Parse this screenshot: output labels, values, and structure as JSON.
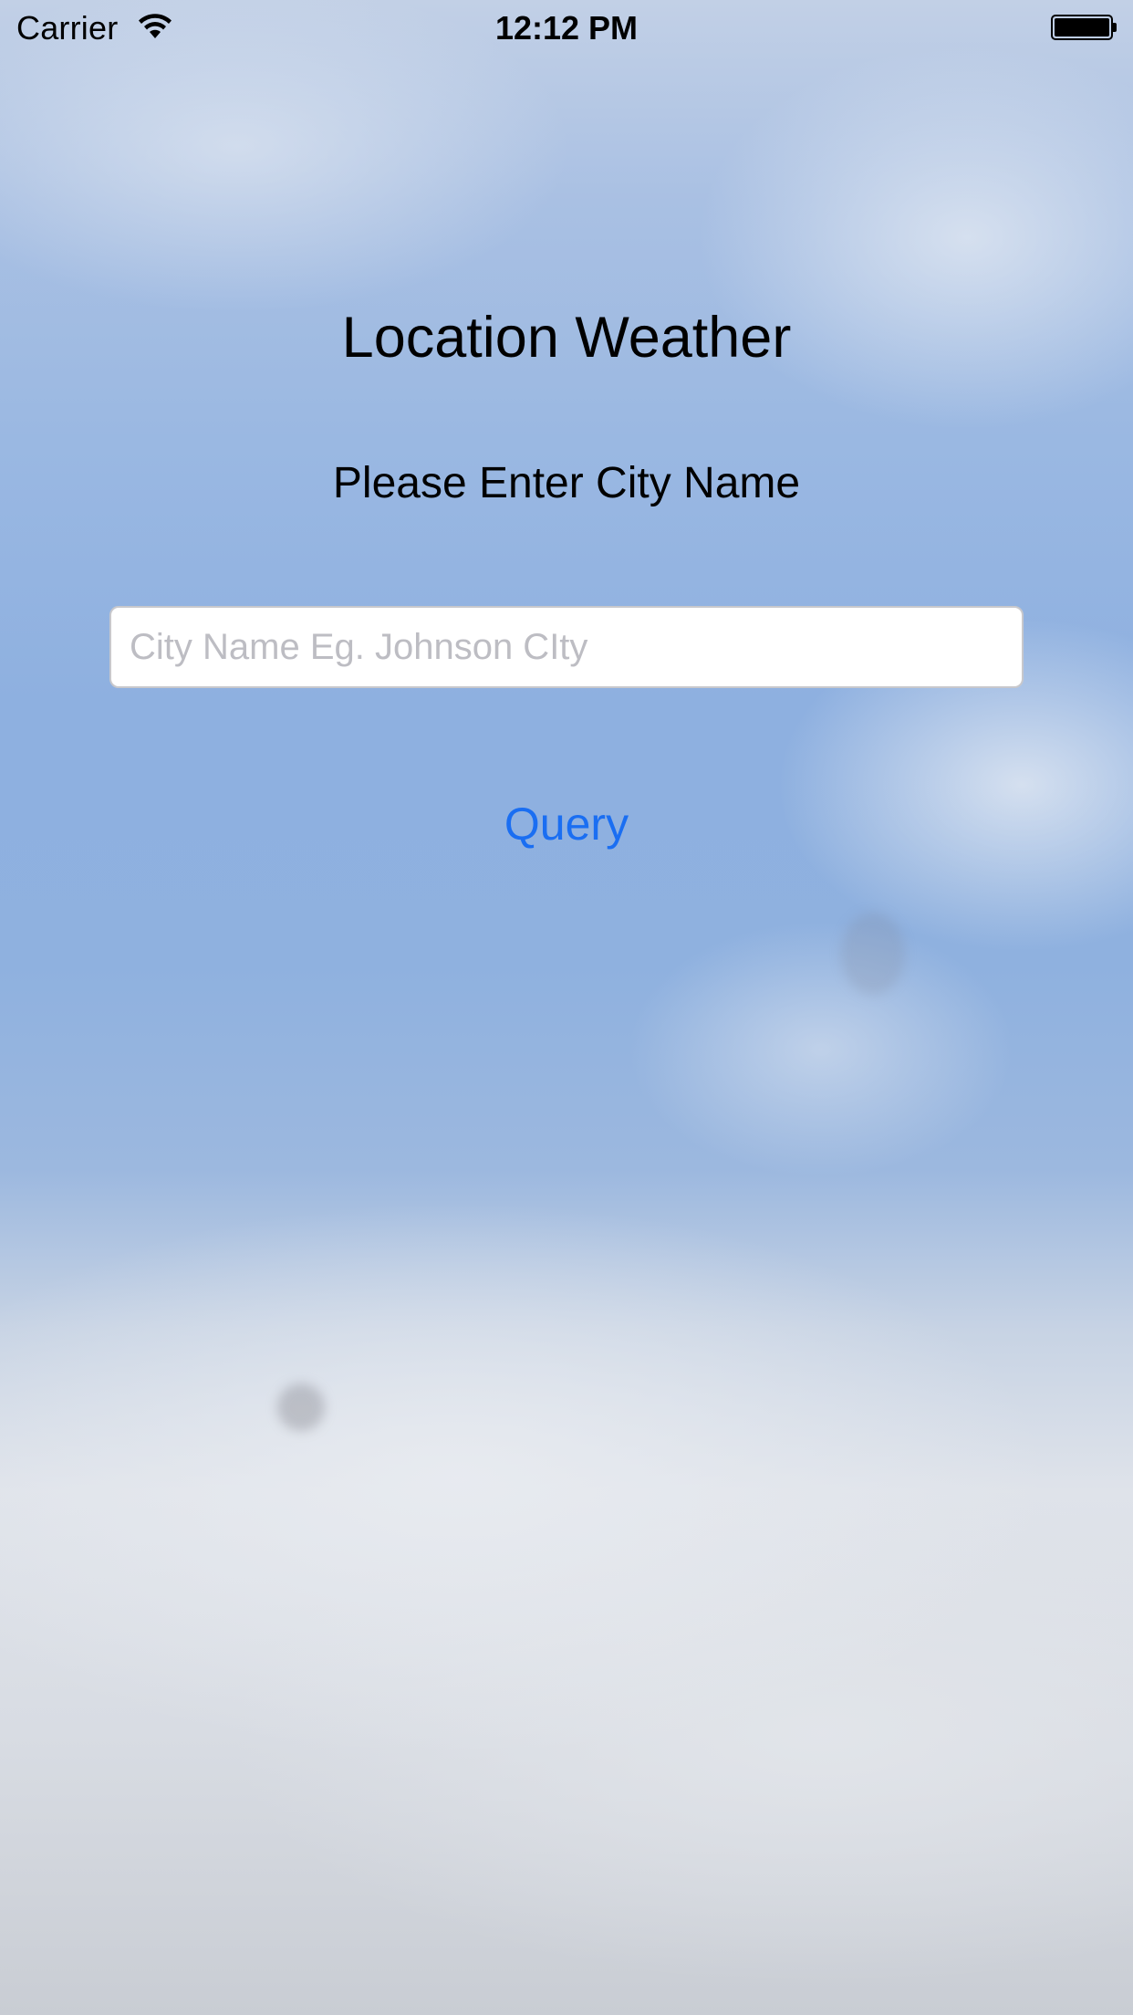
{
  "status_bar": {
    "carrier": "Carrier",
    "time": "12:12 PM",
    "icons": [
      "wifi-icon",
      "battery-icon"
    ]
  },
  "main": {
    "title": "Location Weather",
    "subtitle": "Please Enter City Name",
    "city_input": {
      "value": "",
      "placeholder": "City Name Eg. Johnson CIty"
    },
    "query_button_label": "Query"
  },
  "colors": {
    "accent": "#1a6ef2",
    "placeholder": "#bdbdc3",
    "sky_blue": "#8eb0e0",
    "cloud_white": "#e3e6eb"
  }
}
